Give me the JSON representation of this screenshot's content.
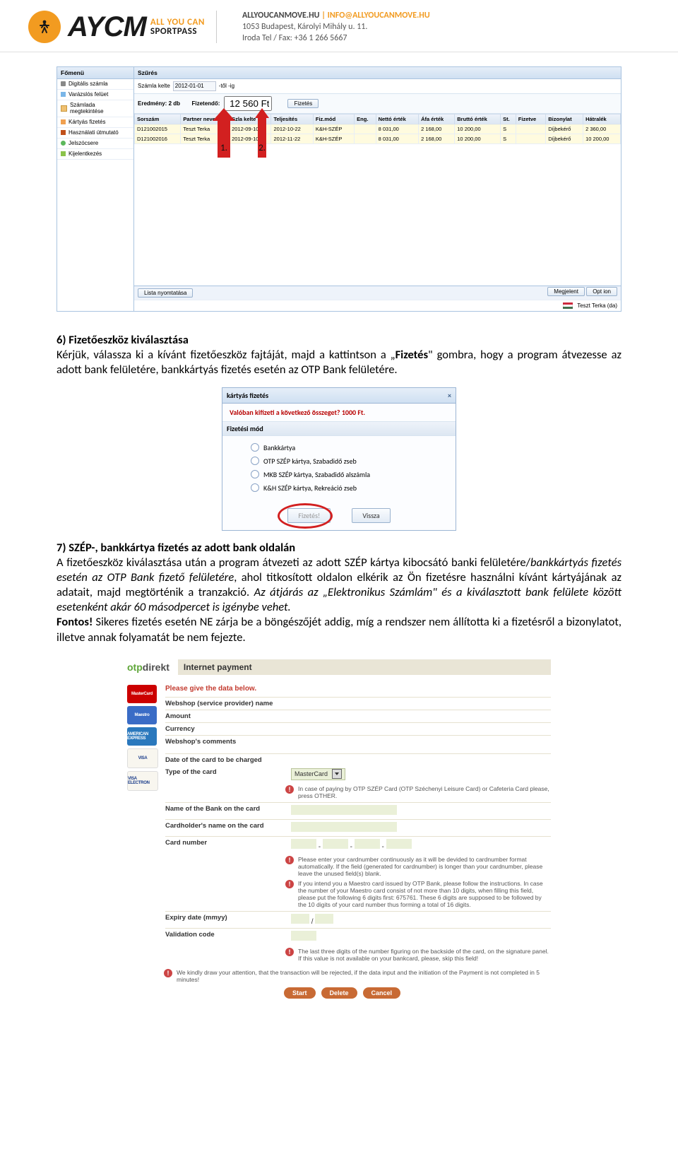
{
  "header": {
    "brand_main": "AYCM",
    "brand_line1": "ALL YOU CAN",
    "brand_line2": "SPORTPASS",
    "contact_line1_a": "ALLYOUCANMOVE.HU",
    "contact_line1_b": "INFO@ALLYOUCANMOVE.HU",
    "contact_line2": "1053 Budapest, Károlyi Mihály u. 11.",
    "contact_line3": "Iroda Tel / Fax: +36 1 266 5667"
  },
  "ss1": {
    "left_header": "Főmenü",
    "right_header": "Szűrés",
    "menu_items": [
      "Digitális számla",
      "Varázslós felüet",
      "Számlada megtekintése",
      "Kártyás fizetés",
      "Használati útmutató",
      "Jelszócsere",
      "Kijelentkezés"
    ],
    "filter_label": "Számla kelte",
    "filter_from": "2012-01-01",
    "filter_to": "-től -ig",
    "result_prefix": "Eredmény: 2 db",
    "result_label": "Fizetendő:",
    "result_value": "12 560 Ft",
    "btn_fizetes": "Fizetés",
    "columns": [
      "Sorszám",
      "Partner neve",
      "Szla kelte",
      "Teljesítés",
      "Fiz.mód",
      "Eng.",
      "Nettó érték",
      "Áfa érték",
      "Bruttó érték",
      "St.",
      "Fizetve",
      "Bizonylat",
      "Hátralék"
    ],
    "rows": [
      [
        "D121002015",
        "Teszt Terka",
        "2012-09-10",
        "2012-10-22",
        "K&H-SZÉP",
        "",
        "8 031,00",
        "2 168,00",
        "10 200,00",
        "S",
        "",
        "Díjbekérő",
        "2 360,00"
      ],
      [
        "D121002016",
        "Teszt Terka",
        "2012-09-10",
        "2012-11-22",
        "K&H-SZÉP",
        "",
        "8 031,00",
        "2 168,00",
        "10 200,00",
        "S",
        "",
        "Díjbekérő",
        "10 200,00"
      ]
    ],
    "bottom_left": "Lista nyomtatása",
    "bottom_right1": "Megjelent",
    "bottom_right2": "Opt ion",
    "footer_user": "Teszt Terka (da)",
    "arrow1_label": "1.",
    "arrow2_label": "2."
  },
  "text": {
    "h6": "6) Fizetőeszköz kiválasztása",
    "p6": "Kérjük, válassza ki a kívánt fizetőeszköz fajtáját, majd a kattintson a „Fizetés\" gombra, hogy a program átvezesse az adott bank felületére, bankkártyás fizetés esetén az OTP Bank felületére.",
    "h7": "7) SZÉP-, bankkártya fizetés az adott bank oldalán",
    "p7a": "A fizetőeszköz kiválasztása után a program átvezeti az adott SZÉP kártya kibocsátó banki felületére/",
    "p7a_i": "bankkártyás fizetés esetén az OTP Bank fizető felületére",
    "p7b": ", ahol titkosított oldalon elkérik az Ön fizetésre használni kívánt kártyájának az adatait, majd megtörténik a tranzakció. ",
    "p7c_i": "Az átjárás az „Elektronikus Számlám\" és a kiválasztott bank felülete között esetenként akár 60 másodpercet is igénybe vehet.",
    "p7d_b": "Fontos!",
    "p7d": " Sikeres fizetés esetén NE zárja be a böngészőjét addig, míg a rendszer nem állította ki a fizetésről a bizonylatot, illetve annak folyamatát be nem fejezte."
  },
  "dialog": {
    "title": "kártyás fizetés",
    "warn": "Valóban kifizeti a következő összeget? 1000 Ft.",
    "section": "Fizetési mód",
    "options": [
      "Bankkártya",
      "OTP SZÉP kártya, Szabadidő zseb",
      "MKB SZÉP kártya, Szabadidő alszámla",
      "K&H SZÉP kártya, Rekreáció zseb"
    ],
    "btn_pay": "Fizetés!",
    "btn_back": "Vissza"
  },
  "otp": {
    "logo_text": "otpdirekt",
    "title": "Internet payment",
    "redline": "Please give the data below.",
    "rows": {
      "webshop": "Webshop (service provider) name",
      "amount": "Amount",
      "currency": "Currency",
      "comments": "Webshop's comments",
      "date": "Date of the card to be charged",
      "type": "Type of the card",
      "type_value": "MasterCard",
      "bank_name": "Name of the Bank on the card",
      "holder": "Cardholder's name on the card",
      "cardnum": "Card number",
      "expiry": "Expiry date (mmyy)",
      "validation": "Validation code"
    },
    "notes": {
      "type_note": "In case of paying by OTP SZÉP Card (OTP Széchenyi Leisure Card) or Cafeteria Card please, press OTHER.",
      "cardnum_note1": "Please enter your cardnumber continuously as it will be devided to cardnumber format automatically. If the field (generated for cardnumber) is longer than your cardnumber, please leave the unused field(s) blank.",
      "cardnum_note2": "If you intend you a Maestro card issued by OTP Bank, please follow the instructions. In case the number of your Maestro card consist of not more than 10 digits, when filling this field, please put the following 6 digits first: 675761. These 6 digits are supposed to be followed by the 10 digits of your card number thus forming a total of 16 digits.",
      "validation_note": "The last three digits of the number figuring on the backside of the card, on the signature panel. If this value is not available on your bankcard, please, skip this field!",
      "footer_note": "We kindly draw your attention, that the transaction will be rejected, if the data input and the initiation of the Payment is not completed in 5 minutes!"
    },
    "buttons": {
      "start": "Start",
      "delete": "Delete",
      "cancel": "Cancel"
    },
    "cards": [
      "MasterCard",
      "Maestro",
      "AMERICAN EXPRESS",
      "VISA",
      "VISA ELECTRON"
    ]
  }
}
